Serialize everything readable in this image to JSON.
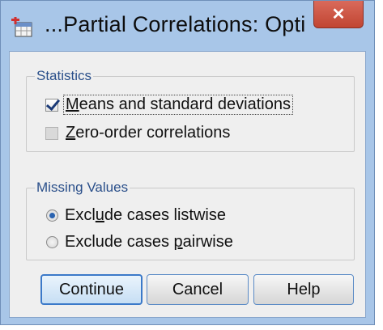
{
  "window": {
    "title": "...Partial Correlations: Opti",
    "close_glyph": "✕",
    "icon": "spss-table-icon"
  },
  "statistics": {
    "title": "Statistics",
    "means_sd": {
      "pre": "",
      "underline": "M",
      "post": "eans and standard deviations",
      "checked": true
    },
    "zero_order": {
      "pre": "",
      "underline": "Z",
      "post": "ero-order correlations",
      "checked": false
    }
  },
  "missing": {
    "title": "Missing Values",
    "listwise": {
      "pre": "Excl",
      "underline": "u",
      "post": "de cases listwise",
      "selected": true
    },
    "pairwise": {
      "pre": "Exclude cases ",
      "underline": "p",
      "post": "airwise",
      "selected": false
    }
  },
  "buttons": {
    "continue": "Continue",
    "cancel": "Cancel",
    "help": "Help"
  },
  "colors": {
    "frame": "#a8c6e8",
    "close": "#c14532",
    "group_title": "#2a4f8a",
    "check": "#1b3a77"
  }
}
